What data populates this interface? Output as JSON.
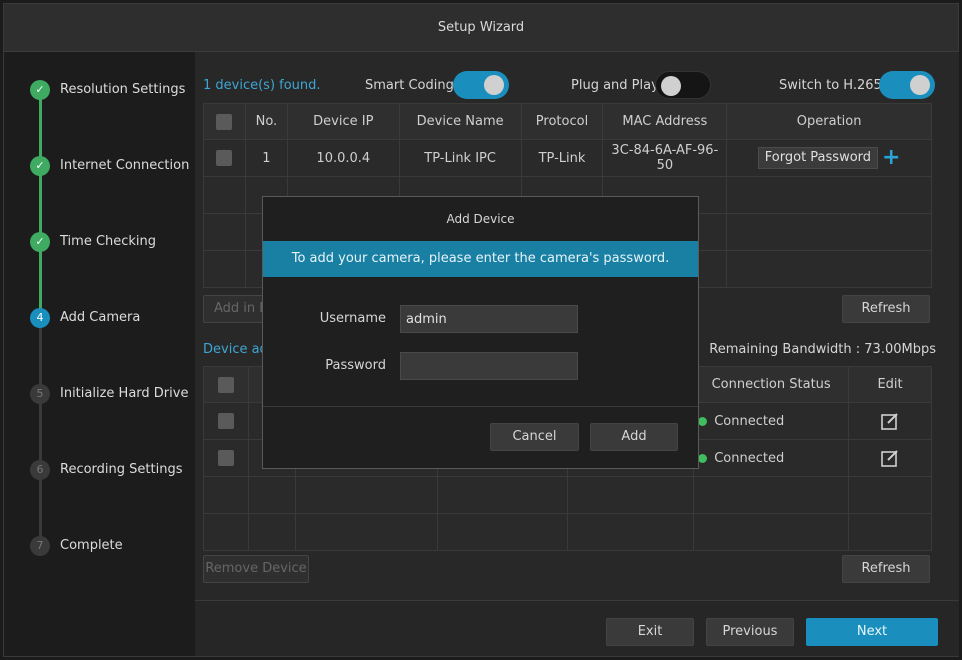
{
  "window": {
    "title": "Setup Wizard"
  },
  "sidebar": {
    "steps": [
      {
        "label": "Resolution Settings",
        "state": "done",
        "marker": "✓"
      },
      {
        "label": "Internet Connection",
        "state": "done",
        "marker": "✓"
      },
      {
        "label": "Time Checking",
        "state": "done",
        "marker": "✓"
      },
      {
        "label": "Add Camera",
        "state": "active",
        "marker": "4"
      },
      {
        "label": "Initialize Hard Drive",
        "state": "todo",
        "marker": "5"
      },
      {
        "label": "Recording Settings",
        "state": "todo",
        "marker": "6"
      },
      {
        "label": "Complete",
        "state": "todo",
        "marker": "7"
      }
    ]
  },
  "found": {
    "text": "1 device(s) found."
  },
  "toggles": {
    "smart_coding": {
      "label": "Smart Coding",
      "on": true
    },
    "plug_and_play": {
      "label": "Plug and Play",
      "on": false
    },
    "h265": {
      "label": "Switch to H.265",
      "on": true
    }
  },
  "found_table": {
    "headers": [
      "No.",
      "Device IP",
      "Device Name",
      "Protocol",
      "MAC Address",
      "Operation"
    ],
    "rows": [
      {
        "no": "1",
        "ip": "10.0.0.4",
        "name": "TP-Link IPC",
        "protocol": "TP-Link",
        "mac": "3C-84-6A-AF-96-50",
        "operation": "Forgot Password"
      }
    ]
  },
  "add_in_batch_label": "Add in Ba",
  "refresh_label": "Refresh",
  "device_added": {
    "label": "Device add"
  },
  "bandwidth": {
    "text": "Remaining Bandwidth : 73.00Mbps"
  },
  "added_table": {
    "headers": {
      "status": "Connection Status",
      "edit": "Edit"
    },
    "rows": [
      {
        "status": "Connected"
      },
      {
        "status": "Connected"
      }
    ]
  },
  "remove_device_label": "Remove Device",
  "footer": {
    "exit": "Exit",
    "previous": "Previous",
    "next": "Next"
  },
  "modal": {
    "title": "Add Device",
    "banner": "To add your camera, please enter the camera's password.",
    "username_label": "Username",
    "username_value": "admin",
    "password_label": "Password",
    "password_value": "",
    "cancel": "Cancel",
    "add": "Add"
  },
  "colors": {
    "accent": "#1a8fbd",
    "done": "#3faa62",
    "connected": "#3fbe5e"
  }
}
